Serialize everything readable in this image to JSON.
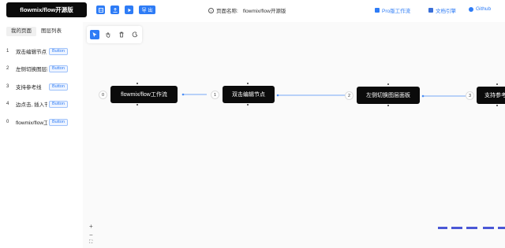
{
  "header": {
    "logo": "flowmix/flow开源版",
    "export_label": "导 出",
    "title_label": "页面名称:",
    "title_value": "flowmix/flow开源版",
    "links": [
      "Pro版工作流",
      "文档引擎",
      "Github"
    ]
  },
  "sidebar": {
    "tabs": [
      "我的页面",
      "图层列表"
    ],
    "layers": [
      {
        "num": "1",
        "label": "双击编辑节点",
        "button": "Button"
      },
      {
        "num": "2",
        "label": "左侧切换图层面板",
        "button": "Button"
      },
      {
        "num": "3",
        "label": "支持参考线",
        "button": "Button"
      },
      {
        "num": "4",
        "label": "边点击, 插入节点",
        "button": "Button"
      },
      {
        "num": "0",
        "label": "flowmix/flow工作流",
        "button": "Button"
      }
    ]
  },
  "canvas": {
    "nodes": [
      {
        "badge": "0",
        "label": "flowmix/flow工作流"
      },
      {
        "badge": "1",
        "label": "双击编辑节点"
      },
      {
        "badge": "2",
        "label": "左侧切换图层面板"
      },
      {
        "badge": "3",
        "label": "支持参考线"
      }
    ],
    "zoom_in": "+",
    "zoom_out": "−",
    "fit": "⛶"
  },
  "colors": {
    "accent": "#2e7cf6",
    "node": "#0b0b0b",
    "edge": "#4a8df6"
  }
}
